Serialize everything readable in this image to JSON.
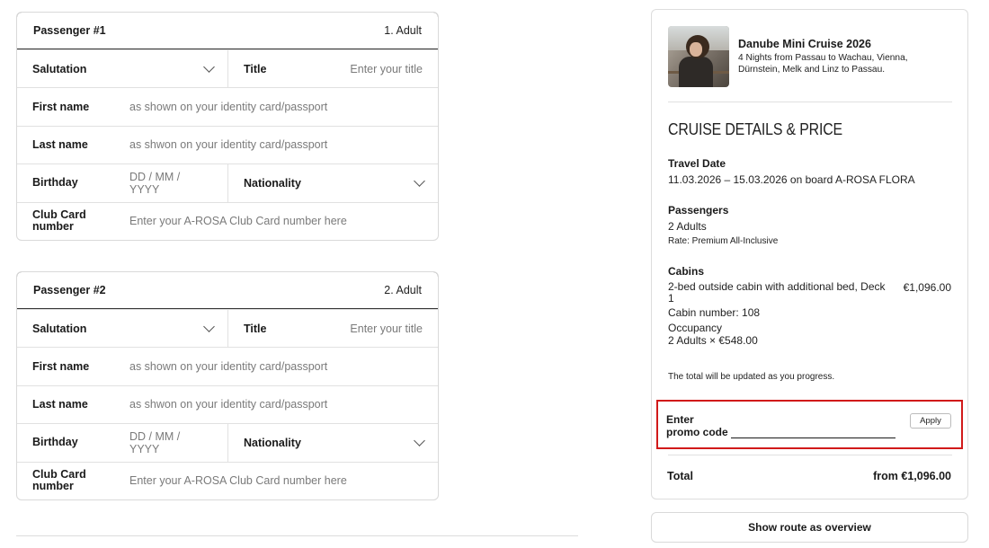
{
  "passengers": [
    {
      "title": "Passenger #1",
      "type": "1. Adult",
      "salutation_label": "Salutation",
      "title_label": "Title",
      "title_placeholder": "Enter your title",
      "first_name_label": "First name",
      "first_name_placeholder": "as shown on your identity card/passport",
      "last_name_label": "Last name",
      "last_name_placeholder": "as shwon on your identity card/passport",
      "birthday_label": "Birthday",
      "birthday_placeholder": "DD / MM / YYYY",
      "nationality_label": "Nationality",
      "club_card_label": "Club Card number",
      "club_card_placeholder": "Enter your A-ROSA Club Card number here"
    },
    {
      "title": "Passenger #2",
      "type": "2. Adult",
      "salutation_label": "Salutation",
      "title_label": "Title",
      "title_placeholder": "Enter your title",
      "first_name_label": "First name",
      "first_name_placeholder": "as shown on your identity card/passport",
      "last_name_label": "Last name",
      "last_name_placeholder": "as shwon on your identity card/passport",
      "birthday_label": "Birthday",
      "birthday_placeholder": "DD / MM / YYYY",
      "nationality_label": "Nationality",
      "club_card_label": "Club Card number",
      "club_card_placeholder": "Enter your A-ROSA Club Card number here"
    }
  ],
  "summary": {
    "cruise_title": "Danube Mini Cruise 2026",
    "cruise_subtitle": "4 Nights from Passau to Wachau, Vienna, Dürnstein, Melk and Linz to Passau.",
    "section_title": "CRUISE DETAILS & PRICE",
    "travel_date_label": "Travel Date",
    "travel_date_value": "11.03.2026 – 15.03.2026 on board A-ROSA FLORA",
    "passengers_label": "Passengers",
    "passengers_value": "2 Adults",
    "rate_value": "Rate: Premium All-Inclusive",
    "cabins_label": "Cabins",
    "cabin_desc": "2-bed outside cabin with additional bed, Deck 1",
    "cabin_price": "€1,096.00",
    "cabin_number": "Cabin number: 108",
    "occupancy_label": "Occupancy",
    "occupancy_value": "2 Adults × €548.00",
    "update_note": "The total will be updated as you progress.",
    "promo_label": "Enter promo code",
    "promo_value": "",
    "apply_label": "Apply",
    "total_label": "Total",
    "total_value": "from €1,096.00",
    "highlight_color": "#d11a1a"
  },
  "route_button_label": "Show route as overview"
}
